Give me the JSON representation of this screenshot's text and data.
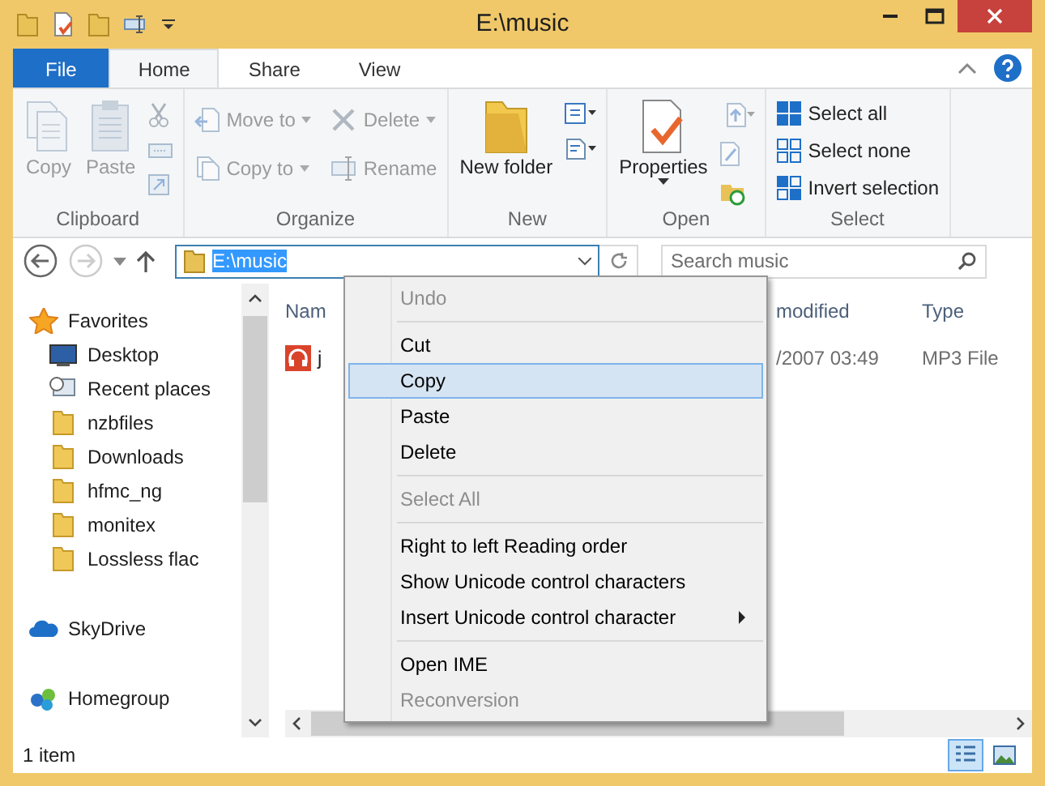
{
  "window": {
    "title": "E:\\music"
  },
  "tabs": [
    {
      "label": "File",
      "kind": "file",
      "selected": false
    },
    {
      "label": "Home",
      "kind": "tab",
      "selected": true
    },
    {
      "label": "Share",
      "kind": "tab",
      "selected": false
    },
    {
      "label": "View",
      "kind": "tab",
      "selected": false
    }
  ],
  "ribbon": {
    "groups": [
      {
        "label": "Clipboard",
        "buttons": [
          {
            "kind": "large",
            "label": "Copy",
            "disabled": true
          },
          {
            "kind": "large",
            "label": "Paste",
            "disabled": true
          }
        ]
      },
      {
        "label": "Organize",
        "buttons": [
          {
            "kind": "small",
            "label": "Move to",
            "disabled": true,
            "dropdown": true
          },
          {
            "kind": "small",
            "label": "Copy to",
            "disabled": true,
            "dropdown": true
          },
          {
            "kind": "small",
            "label": "Delete",
            "disabled": true,
            "dropdown": true
          },
          {
            "kind": "small",
            "label": "Rename",
            "disabled": true,
            "dropdown": false
          }
        ]
      },
      {
        "label": "New",
        "buttons": [
          {
            "kind": "large",
            "label": "New folder",
            "disabled": false
          }
        ]
      },
      {
        "label": "Open",
        "buttons": [
          {
            "kind": "large",
            "label": "Properties",
            "disabled": false
          }
        ]
      },
      {
        "label": "Select",
        "buttons": [
          {
            "kind": "small",
            "label": "Select all",
            "disabled": false,
            "dropdown": false
          },
          {
            "kind": "small",
            "label": "Select none",
            "disabled": false,
            "dropdown": false
          },
          {
            "kind": "small",
            "label": "Invert selection",
            "disabled": false,
            "dropdown": false
          }
        ]
      }
    ]
  },
  "address": {
    "value": "E:\\music"
  },
  "search": {
    "placeholder": "Search music"
  },
  "nav": [
    {
      "label": "Favorites",
      "children": [
        {
          "label": "Desktop"
        },
        {
          "label": "Recent places"
        },
        {
          "label": "nzbfiles"
        },
        {
          "label": "Downloads"
        },
        {
          "label": "hfmc_ng"
        },
        {
          "label": "monitex"
        },
        {
          "label": "Lossless flac"
        }
      ]
    },
    {
      "label": "SkyDrive"
    },
    {
      "label": "Homegroup"
    }
  ],
  "table": {
    "columns": [
      "Nam",
      "modified",
      "Type"
    ],
    "rows": [
      {
        "name": "j",
        "modified": "/2007 03:49",
        "type": "MP3 File"
      }
    ]
  },
  "context_menu": [
    {
      "kind": "item",
      "label": "Undo",
      "disabled": true,
      "selected": false,
      "submenu": false
    },
    {
      "kind": "separator"
    },
    {
      "kind": "item",
      "label": "Cut",
      "disabled": false,
      "selected": false,
      "submenu": false
    },
    {
      "kind": "item",
      "label": "Copy",
      "disabled": false,
      "selected": true,
      "submenu": false
    },
    {
      "kind": "item",
      "label": "Paste",
      "disabled": false,
      "selected": false,
      "submenu": false
    },
    {
      "kind": "item",
      "label": "Delete",
      "disabled": false,
      "selected": false,
      "submenu": false
    },
    {
      "kind": "separator"
    },
    {
      "kind": "item",
      "label": "Select All",
      "disabled": true,
      "selected": false,
      "submenu": false
    },
    {
      "kind": "separator"
    },
    {
      "kind": "item",
      "label": "Right to left Reading order",
      "disabled": false,
      "selected": false,
      "submenu": false
    },
    {
      "kind": "item",
      "label": "Show Unicode control characters",
      "disabled": false,
      "selected": false,
      "submenu": false
    },
    {
      "kind": "item",
      "label": "Insert Unicode control character",
      "disabled": false,
      "selected": false,
      "submenu": true
    },
    {
      "kind": "separator"
    },
    {
      "kind": "item",
      "label": "Open IME",
      "disabled": false,
      "selected": false,
      "submenu": false
    },
    {
      "kind": "item",
      "label": "Reconversion",
      "disabled": true,
      "selected": false,
      "submenu": false
    }
  ],
  "status_bar": {
    "text": "1 item"
  }
}
